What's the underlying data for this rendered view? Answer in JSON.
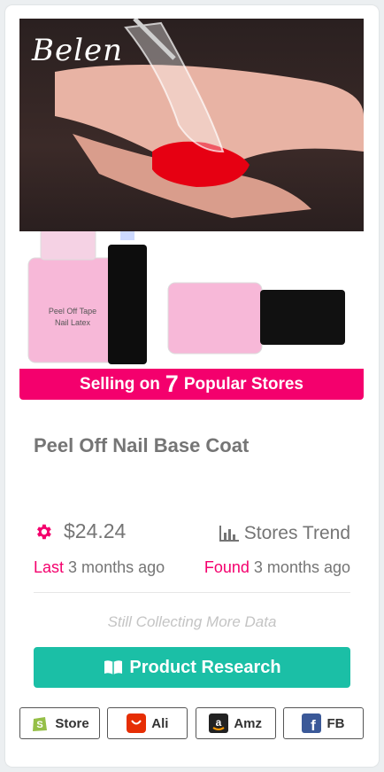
{
  "product": {
    "brand_logo_text": "Belen",
    "promo": {
      "prefix": "Selling on",
      "count": "7",
      "suffix": "Popular Stores"
    },
    "title": "Peel Off Nail Base Coat",
    "price": "$24.24",
    "trend_label": "Stores Trend",
    "last": {
      "key": "Last",
      "value": "3 months ago"
    },
    "found": {
      "key": "Found",
      "value": "3 months ago"
    },
    "status_note": "Still Collecting More Data",
    "research_button_label": "Product Research",
    "bottle_label_text": "Peel Off Tape Nail Latex"
  },
  "stores": [
    {
      "label": "Store",
      "icon": "shopify-icon"
    },
    {
      "label": "Ali",
      "icon": "aliexpress-icon"
    },
    {
      "label": "Amz",
      "icon": "amazon-icon"
    },
    {
      "label": "FB",
      "icon": "facebook-icon"
    }
  ],
  "colors": {
    "accent_pink": "#f4006d",
    "teal_button": "#1bbfa6",
    "text_gray": "#757575"
  }
}
